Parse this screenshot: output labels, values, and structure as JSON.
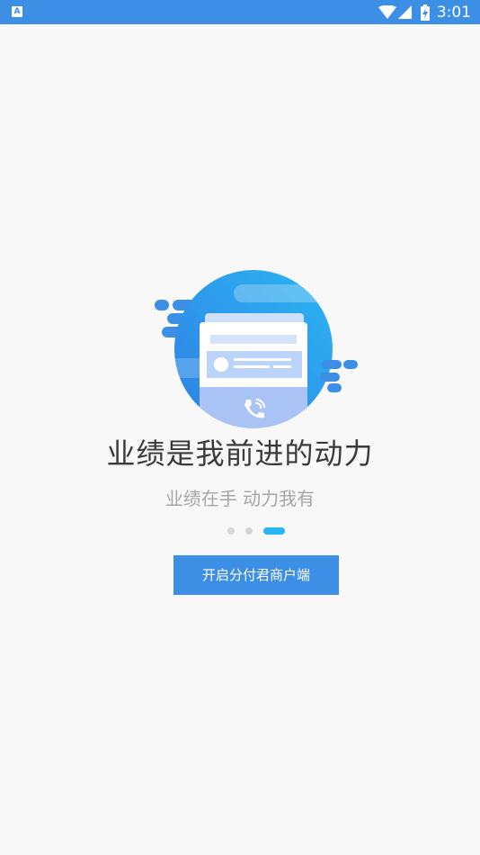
{
  "status_bar": {
    "notification_icon": "A",
    "icons": [
      "wifi-icon",
      "cellular-signal-icon",
      "battery-charging-icon"
    ],
    "time": "3:01"
  },
  "illustration": {
    "icon": "phone-call-icon",
    "colors": {
      "circle": "#3d8fe6",
      "circle_light": "#29b6f2",
      "card": "#ffffff",
      "card_accent": "#a8c8f8"
    }
  },
  "onboarding": {
    "headline": "业绩是我前进的动力",
    "subline": "业绩在手 动力我有",
    "pager": {
      "count": 3,
      "active_index": 2
    }
  },
  "start_button": {
    "label": "开启分付君商户端"
  },
  "colors": {
    "status_bar": "#3d8fe6",
    "button": "#3d8fe6",
    "active_dot": "#29b6f2",
    "inactive_dot": "#d6d6d6",
    "headline": "#3a3a3a",
    "subline": "#a6a6a6",
    "background": "#f8f8f8"
  }
}
